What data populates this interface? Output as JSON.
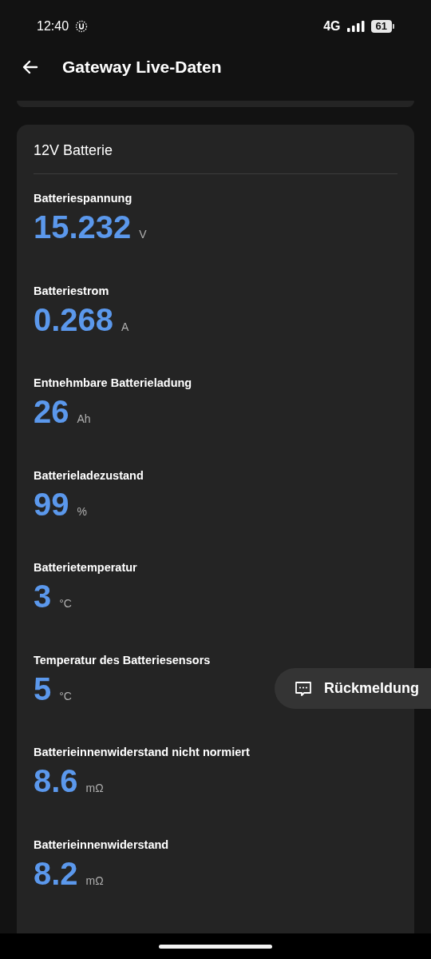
{
  "status_bar": {
    "time": "12:40",
    "network": "4G",
    "battery": "61"
  },
  "app_bar": {
    "title": "Gateway Live-Daten"
  },
  "card": {
    "title": "12V Batterie",
    "metrics": [
      {
        "label": "Batteriespannung",
        "value": "15.232",
        "unit": "V"
      },
      {
        "label": "Batteriestrom",
        "value": "0.268",
        "unit": "A"
      },
      {
        "label": "Entnehmbare Batterieladung",
        "value": "26",
        "unit": "Ah"
      },
      {
        "label": "Batterieladezustand",
        "value": "99",
        "unit": "%"
      },
      {
        "label": "Batterietemperatur",
        "value": "3",
        "unit": "°C"
      },
      {
        "label": "Temperatur des Batteriesensors",
        "value": "5",
        "unit": "°C"
      },
      {
        "label": "Batterieinnenwiderstand nicht normiert",
        "value": "8.6",
        "unit": "mΩ"
      },
      {
        "label": "Batterieinnenwiderstand",
        "value": "8.2",
        "unit": "mΩ"
      }
    ]
  },
  "feedback_button": {
    "label": "Rückmeldung"
  }
}
